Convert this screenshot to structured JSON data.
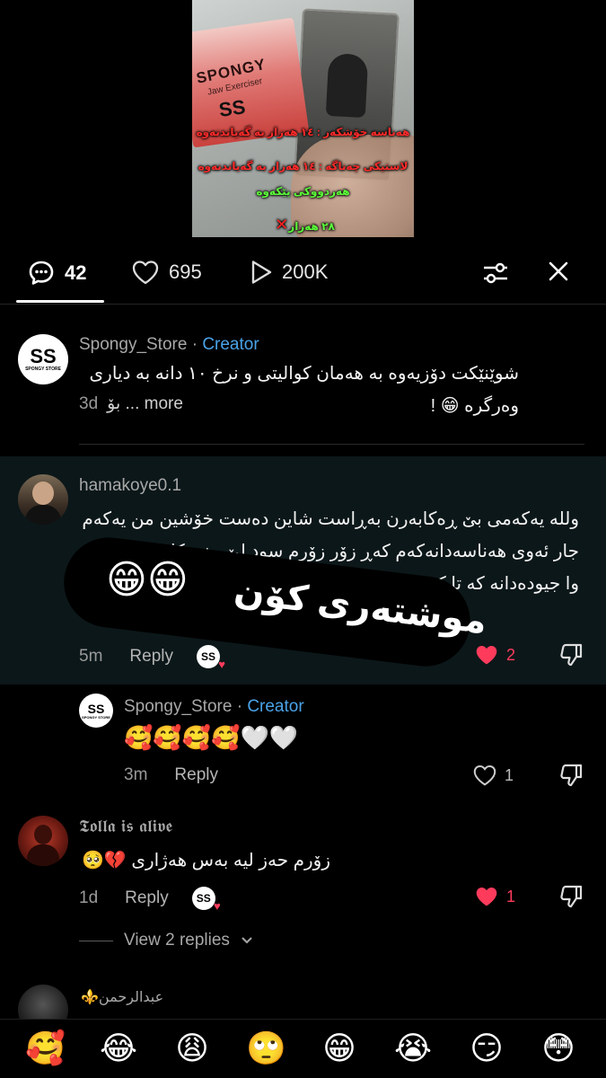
{
  "video": {
    "brand": "SPONGY",
    "subtitle": "Jaw Exerciser",
    "logo": "SS",
    "lines": [
      {
        "text": "هەناسە خۆشکەر : ١٤ هەزار بە گەیاندنەوە",
        "color": "red"
      },
      {
        "text": "لاستیکی چەناگە : ١٤ هەزار بە گەیاندنەوە",
        "color": "red"
      },
      {
        "text": "هەردووکی پێکەوە",
        "color": "green"
      },
      {
        "text": "٢٨ هەزار",
        "color": "green"
      }
    ]
  },
  "actions": {
    "comments_count": "42",
    "likes_count": "695",
    "views_count": "200K",
    "icons": [
      "comment-icon",
      "heart-icon",
      "play-icon",
      "filter-icon",
      "close-icon"
    ]
  },
  "comments": [
    {
      "username": "Spongy_Store",
      "separator": " · ",
      "badge": "Creator",
      "text": "شوێنێکت دۆزیەوە بە هەمان کوالیتی و نرخ ١٠ دانە بە دیاری وەرگرە 😁 !",
      "more_label": "بۆ ... more",
      "time": "3d"
    },
    {
      "username": "hamakoye0.1",
      "text": "وللە یەکەمی بێ ڕەکابەرن بەڕاست شاین دەست خۆشین من یەکەم جار ئەوی هەناسەدانەکەم کەڕ زۆر زۆرم سود لێ بینی کاتێکیش ناردە وا جیودەدانە کە تا کەوتن",
      "time": "5m",
      "reply_label": "Reply",
      "likes": "2",
      "liked": true
    },
    {
      "username": "Spongy_Store",
      "separator": " · ",
      "badge": "Creator",
      "text": "🥰🥰🥰🥰🤍🤍",
      "time": "3m",
      "reply_label": "Reply",
      "likes": "1",
      "liked": false
    },
    {
      "username": "𝕿𝖔𝖑𝖑𝖆 𝖎𝖘 𝖆𝖑𝖎𝖛𝖊",
      "text": "زۆرم حەز لیە بەس هەژاری 💔🥺",
      "time": "1d",
      "reply_label": "Reply",
      "likes": "1",
      "liked": true
    },
    {
      "username": "⚜️عبدالرحمن"
    }
  ],
  "sticker": {
    "text": "موشتەری کۆن",
    "emojis": "😁😁"
  },
  "view_replies": "View 2 replies",
  "emoji_bar": [
    "🥰",
    "😂",
    "😩",
    "🙄",
    "😁",
    "😭",
    "😏",
    "😳"
  ],
  "colors": {
    "creator": "#4aa3e8",
    "like": "#ff3b5c",
    "highlight": "#0c1719"
  }
}
